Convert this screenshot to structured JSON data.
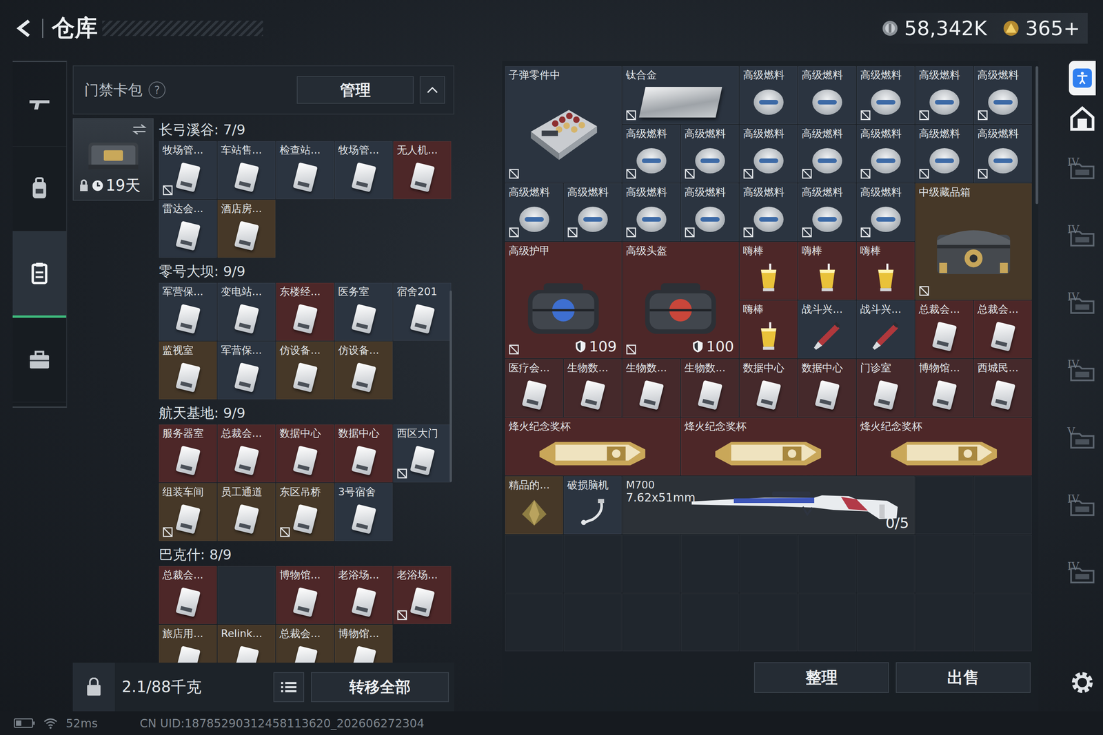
{
  "header": {
    "title": "仓库",
    "currency": [
      {
        "value": "58,342K"
      },
      {
        "value": "365+"
      }
    ]
  },
  "left_rail": [
    {
      "selected": false
    },
    {
      "selected": false
    },
    {
      "selected": true
    },
    {
      "selected": false
    }
  ],
  "card_pack": {
    "title": "门禁卡包",
    "help": "?",
    "manage": "管理",
    "timer": "19天",
    "groups": [
      {
        "name": "长弓溪谷: 7/9",
        "cards": [
          {
            "name": "牧场管...",
            "color": "#2b3440",
            "bound": true,
            "empty": false
          },
          {
            "name": "车站售...",
            "color": "#2b3440",
            "bound": false,
            "empty": false
          },
          {
            "name": "检查站...",
            "color": "#2b3440",
            "bound": false,
            "empty": false
          },
          {
            "name": "牧场管...",
            "color": "#2b3440",
            "bound": false,
            "empty": false
          },
          {
            "name": "无人机...",
            "color": "#4d2728",
            "bound": false,
            "empty": false
          },
          {
            "name": "雷达会...",
            "color": "#2b3440",
            "bound": false,
            "empty": false
          },
          {
            "name": "酒店房...",
            "color": "#463828",
            "bound": false,
            "empty": false
          }
        ]
      },
      {
        "name": "零号大坝: 9/9",
        "cards": [
          {
            "name": "军营保...",
            "color": "#2b3440",
            "bound": false,
            "empty": false
          },
          {
            "name": "变电站...",
            "color": "#2b3440",
            "bound": false,
            "empty": false
          },
          {
            "name": "东楼经...",
            "color": "#4d2728",
            "bound": false,
            "empty": false
          },
          {
            "name": "医务室",
            "color": "#2b3440",
            "bound": false,
            "empty": false
          },
          {
            "name": "宿舍201",
            "color": "#2b3440",
            "bound": false,
            "empty": false
          },
          {
            "name": "监视室",
            "color": "#463828",
            "bound": false,
            "empty": false
          },
          {
            "name": "军营保...",
            "color": "#2b3440",
            "bound": false,
            "empty": false
          },
          {
            "name": "仿设备...",
            "color": "#463828",
            "bound": false,
            "empty": false
          },
          {
            "name": "仿设备...",
            "color": "#463828",
            "bound": false,
            "empty": false
          }
        ]
      },
      {
        "name": "航天基地: 9/9",
        "cards": [
          {
            "name": "服务器室",
            "color": "#4d2728",
            "bound": false,
            "empty": false
          },
          {
            "name": "总裁会...",
            "color": "#4d2728",
            "bound": false,
            "empty": false
          },
          {
            "name": "数据中心",
            "color": "#4d2728",
            "bound": false,
            "empty": false
          },
          {
            "name": "数据中心",
            "color": "#4d2728",
            "bound": false,
            "empty": false
          },
          {
            "name": "西区大门",
            "color": "#2b3440",
            "bound": true,
            "empty": false
          },
          {
            "name": "组装车间",
            "color": "#463828",
            "bound": true,
            "empty": false
          },
          {
            "name": "员工通道",
            "color": "#463828",
            "bound": false,
            "empty": false
          },
          {
            "name": "东区吊桥",
            "color": "#463828",
            "bound": true,
            "empty": false
          },
          {
            "name": "3号宿舍",
            "color": "#2b3440",
            "bound": false,
            "empty": false
          }
        ]
      },
      {
        "name": "巴克什: 8/9",
        "cards": [
          {
            "name": "总裁会...",
            "color": "#4d2728",
            "bound": false,
            "empty": false
          },
          {
            "name": "",
            "color": "#252c34",
            "bound": false,
            "empty": true
          },
          {
            "name": "博物馆...",
            "color": "#4d2728",
            "bound": false,
            "empty": false
          },
          {
            "name": "老浴场...",
            "color": "#4d2728",
            "bound": false,
            "empty": false
          },
          {
            "name": "老浴场...",
            "color": "#4d2728",
            "bound": true,
            "empty": false
          },
          {
            "name": "旅店用...",
            "color": "#463828",
            "bound": false,
            "empty": false
          },
          {
            "name": "Relink...",
            "color": "#463828",
            "bound": false,
            "empty": false
          },
          {
            "name": "总裁会...",
            "color": "#463828",
            "bound": false,
            "empty": false
          },
          {
            "name": "博物馆...",
            "color": "#463828",
            "bound": false,
            "empty": false
          }
        ]
      }
    ],
    "weight": "2.1/88千克",
    "transfer": "转移全部"
  },
  "stash": {
    "items": [
      {
        "name": "子弹零件中",
        "kind": "ammo-box",
        "color": "#2b3440",
        "bound": true
      },
      {
        "name": "钛合金",
        "kind": "alloy",
        "color": "#2b3440",
        "bound": true
      },
      {
        "name": "高级燃料",
        "kind": "fuel",
        "color": "#2b3440",
        "bound": false
      },
      {
        "name": "高级燃料",
        "kind": "fuel",
        "color": "#2b3440",
        "bound": false
      },
      {
        "name": "高级燃料",
        "kind": "fuel",
        "color": "#2b3440",
        "bound": true
      },
      {
        "name": "高级燃料",
        "kind": "fuel",
        "color": "#2b3440",
        "bound": true
      },
      {
        "name": "高级燃料",
        "kind": "fuel",
        "color": "#2b3440",
        "bound": true
      },
      {
        "name": "高级燃料",
        "kind": "fuel",
        "color": "#2b3440",
        "bound": true
      },
      {
        "name": "高级燃料",
        "kind": "fuel",
        "color": "#2b3440",
        "bound": true
      },
      {
        "name": "高级燃料",
        "kind": "fuel",
        "color": "#2b3440",
        "bound": true
      },
      {
        "name": "高级燃料",
        "kind": "fuel",
        "color": "#2b3440",
        "bound": true
      },
      {
        "name": "高级燃料",
        "kind": "fuel",
        "color": "#2b3440",
        "bound": true
      },
      {
        "name": "高级燃料",
        "kind": "fuel",
        "color": "#2b3440",
        "bound": true
      },
      {
        "name": "高级燃料",
        "kind": "fuel",
        "color": "#2b3440",
        "bound": true
      },
      {
        "name": "高级燃料",
        "kind": "fuel",
        "color": "#2b3440",
        "bound": true
      },
      {
        "name": "高级燃料",
        "kind": "fuel",
        "color": "#2b3440",
        "bound": true
      },
      {
        "name": "高级燃料",
        "kind": "fuel",
        "color": "#2b3440",
        "bound": true
      },
      {
        "name": "高级燃料",
        "kind": "fuel",
        "color": "#2b3440",
        "bound": true
      },
      {
        "name": "高级燃料",
        "kind": "fuel",
        "color": "#2b3440",
        "bound": true
      },
      {
        "name": "高级燃料",
        "kind": "fuel",
        "color": "#2b3440",
        "bound": true
      },
      {
        "name": "高级燃料",
        "kind": "fuel",
        "color": "#2b3440",
        "bound": true
      },
      {
        "name": "中级藏品箱",
        "kind": "crate",
        "color": "#463828",
        "bound": true
      },
      {
        "name": "高级护甲",
        "kind": "armor",
        "color": "#4d2728",
        "bound": true,
        "durability": "109"
      },
      {
        "name": "高级头盔",
        "kind": "helmet",
        "color": "#4d2728",
        "bound": true,
        "durability": "100"
      },
      {
        "name": "嗨棒",
        "kind": "drink",
        "color": "#4d2728",
        "bound": false
      },
      {
        "name": "嗨棒",
        "kind": "drink",
        "color": "#4d2728",
        "bound": false
      },
      {
        "name": "嗨棒",
        "kind": "drink",
        "color": "#4d2728",
        "bound": false
      },
      {
        "name": "嗨棒",
        "kind": "drink",
        "color": "#4d2728",
        "bound": false
      },
      {
        "name": "战斗兴...",
        "kind": "injector",
        "color": "#2b3440",
        "bound": false
      },
      {
        "name": "战斗兴...",
        "kind": "injector",
        "color": "#2b3440",
        "bound": false
      },
      {
        "name": "总裁会...",
        "kind": "card",
        "color": "#4d2728",
        "bound": false
      },
      {
        "name": "总裁会...",
        "kind": "card",
        "color": "#4d2728",
        "bound": false
      },
      {
        "name": "医疗会...",
        "kind": "card",
        "color": "#45292b",
        "bound": false
      },
      {
        "name": "生物数...",
        "kind": "card",
        "color": "#45292b",
        "bound": false
      },
      {
        "name": "生物数...",
        "kind": "card",
        "color": "#45292b",
        "bound": false
      },
      {
        "name": "生物数...",
        "kind": "card",
        "color": "#45292b",
        "bound": false
      },
      {
        "name": "数据中心",
        "kind": "card",
        "color": "#45292b",
        "bound": false
      },
      {
        "name": "数据中心",
        "kind": "card",
        "color": "#45292b",
        "bound": false
      },
      {
        "name": "门诊室",
        "kind": "card",
        "color": "#45292b",
        "bound": false
      },
      {
        "name": "博物馆...",
        "kind": "card",
        "color": "#45292b",
        "bound": false
      },
      {
        "name": "西城民...",
        "kind": "card",
        "color": "#45292b",
        "bound": false
      },
      {
        "name": "烽火纪念奖杯",
        "kind": "trophy",
        "color": "#4d2728",
        "bound": false
      },
      {
        "name": "烽火纪念奖杯",
        "kind": "trophy",
        "color": "#4d2728",
        "bound": false
      },
      {
        "name": "烽火纪念奖杯",
        "kind": "trophy",
        "color": "#4d2728",
        "bound": false
      },
      {
        "name": "精品的...",
        "kind": "gem",
        "color": "#463828",
        "bound": false
      },
      {
        "name": "破损脑机",
        "kind": "chip",
        "color": "#2b3440",
        "bound": false
      },
      {
        "name": "M700",
        "kind": "rifle",
        "color": "#2c3137",
        "bound": false,
        "caliber": "7.62x51mm",
        "ammo": "0/5"
      }
    ],
    "buttons": [
      "整理",
      "出售"
    ]
  },
  "right_rail": {
    "tabs": [
      {
        "label": "IV"
      },
      {
        "label": "IV"
      },
      {
        "label": "IV"
      },
      {
        "label": "IV"
      },
      {
        "label": "V"
      },
      {
        "label": "IV"
      },
      {
        "label": "IV"
      }
    ]
  },
  "status_bar": {
    "ping": "52ms",
    "uid": "CN UID:18785290312458113620_202606272304"
  }
}
